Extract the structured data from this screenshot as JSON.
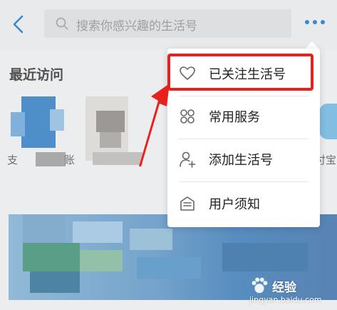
{
  "header": {
    "search_placeholder": "搜索你感兴趣的生活号"
  },
  "recent": {
    "title": "最近访问",
    "items": [
      {
        "label": "支"
      },
      {
        "label": "账"
      },
      {
        "label": ""
      },
      {
        "label": "付宝"
      }
    ]
  },
  "menu": {
    "items": [
      {
        "label": "已关注生活号",
        "icon": "heart-icon"
      },
      {
        "label": "常用服务",
        "icon": "grid-icon"
      },
      {
        "label": "添加生活号",
        "icon": "add-user-icon"
      },
      {
        "label": "用户须知",
        "icon": "notice-icon"
      }
    ]
  },
  "watermark": {
    "brand": "Bai 百度",
    "product": "经验",
    "url": "jingyan.baidu.com"
  },
  "colors": {
    "highlight": "#e8211c",
    "accent": "#1a73c8"
  }
}
